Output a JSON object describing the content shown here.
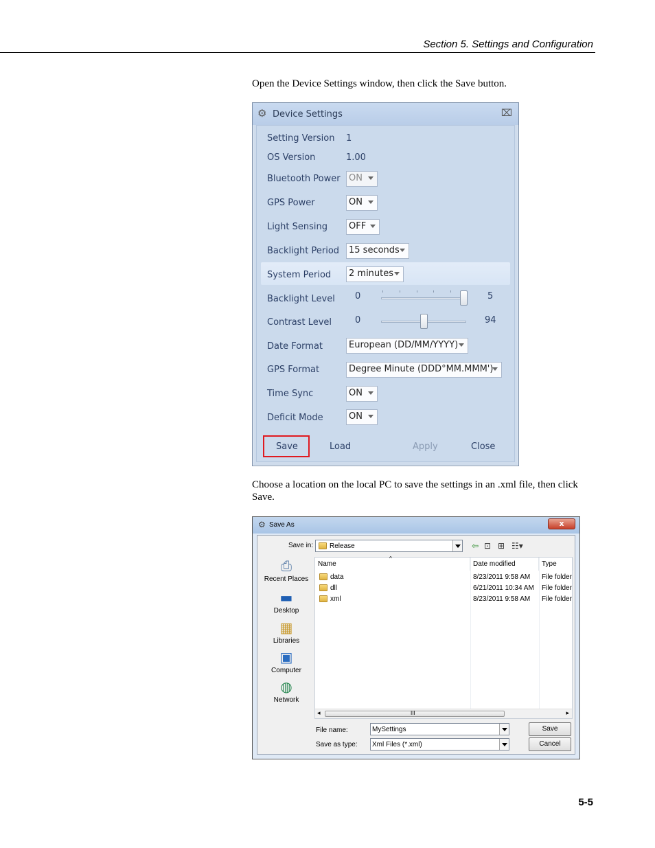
{
  "header": {
    "section_title": "Section 5.  Settings and Configuration"
  },
  "paragraphs": {
    "first": "Open the Device Settings window, then click the Save button.",
    "second": "Choose a location on the local PC to save the settings in an .xml file, then click Save."
  },
  "device_settings": {
    "title": "Device Settings",
    "close_glyph": "⌧",
    "rows": {
      "setting_version": {
        "label": "Setting Version",
        "value": "1"
      },
      "os_version": {
        "label": "OS Version",
        "value": "1.00"
      },
      "bluetooth_power": {
        "label": "Bluetooth Power",
        "value": "ON"
      },
      "gps_power": {
        "label": "GPS Power",
        "value": "ON"
      },
      "light_sensing": {
        "label": "Light Sensing",
        "value": "OFF"
      },
      "backlight_period": {
        "label": "Backlight Period",
        "value": "15 seconds"
      },
      "system_period": {
        "label": "System Period",
        "value": "2 minutes"
      },
      "backlight_level": {
        "label": "Backlight Level",
        "min": "0",
        "max": "5",
        "level": 5
      },
      "contrast_level": {
        "label": "Contrast Level",
        "min": "0",
        "max": "94",
        "level": 47
      },
      "date_format": {
        "label": "Date Format",
        "value": "European (DD/MM/YYYY)"
      },
      "gps_format": {
        "label": "GPS Format",
        "value": "Degree Minute (DDD°MM.MMM')"
      },
      "time_sync": {
        "label": "Time Sync",
        "value": "ON"
      },
      "deficit_mode": {
        "label": "Deficit Mode",
        "value": "ON"
      }
    },
    "buttons": {
      "save": "Save",
      "load": "Load",
      "apply": "Apply",
      "close": "Close"
    },
    "highlight_color": "#e0191f"
  },
  "save_as": {
    "title": "Save As",
    "close_glyph": "x",
    "save_in_label": "Save in:",
    "save_in_value": "Release",
    "places": [
      "Recent Places",
      "Desktop",
      "Libraries",
      "Computer",
      "Network"
    ],
    "columns": {
      "name": "Name",
      "date": "Date modified",
      "type": "Type"
    },
    "files": [
      {
        "name": "data",
        "date": "8/23/2011 9:58 AM",
        "type": "File folder"
      },
      {
        "name": "dll",
        "date": "6/21/2011 10:34 AM",
        "type": "File folder"
      },
      {
        "name": "xml",
        "date": "8/23/2011 9:58 AM",
        "type": "File folder"
      }
    ],
    "scroll_mark": "III",
    "file_name_label": "File name:",
    "file_name_value": "MySettings",
    "save_type_label": "Save as type:",
    "save_type_value": "Xml Files (*.xml)",
    "save_button": "Save",
    "cancel_button": "Cancel"
  },
  "page_number": "5-5"
}
